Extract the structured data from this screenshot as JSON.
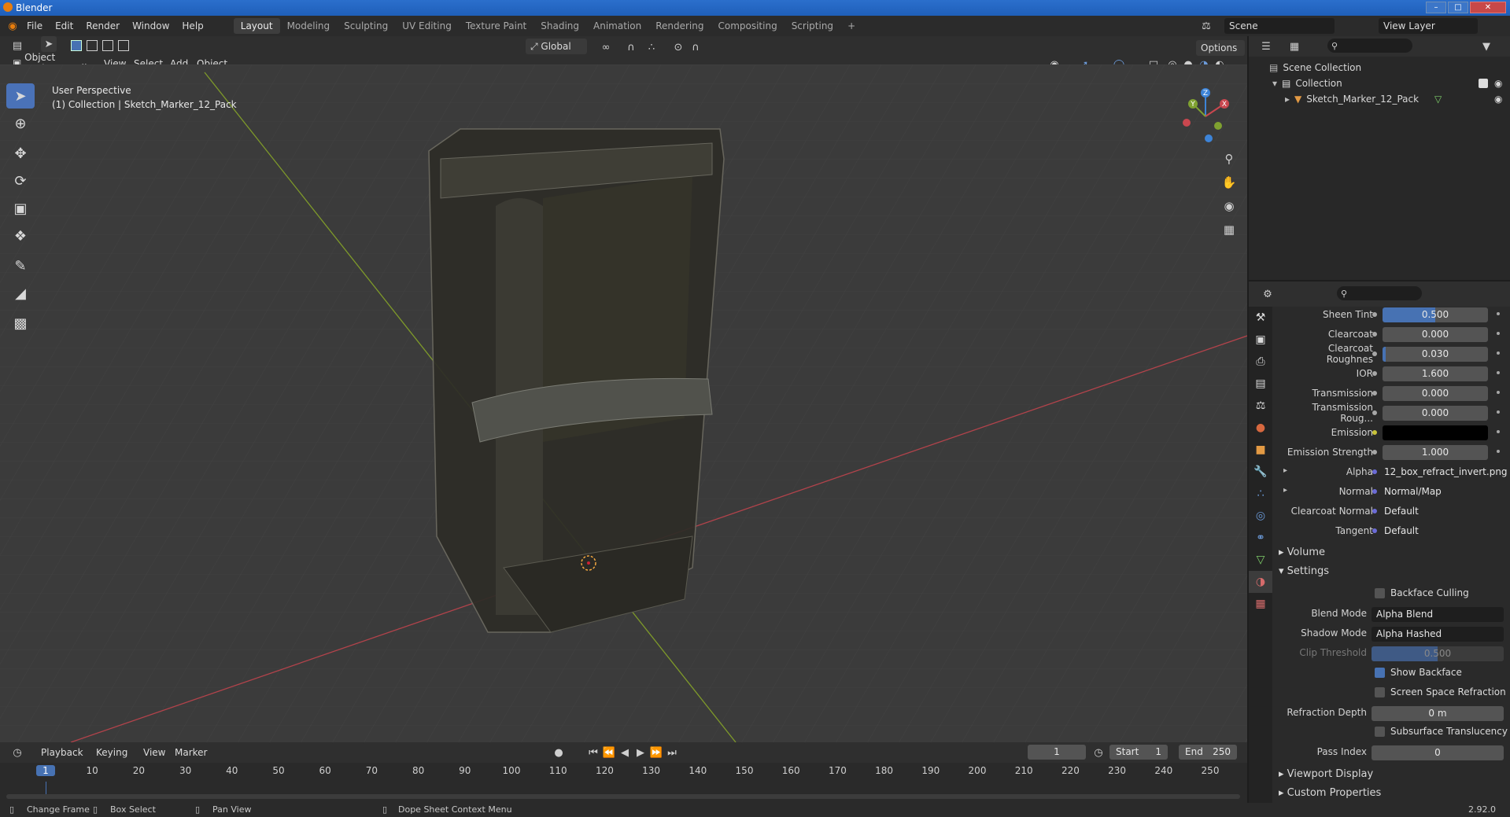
{
  "window": {
    "title": "Blender"
  },
  "menu": [
    "File",
    "Edit",
    "Render",
    "Window",
    "Help"
  ],
  "workspaces": [
    {
      "label": "Layout",
      "active": true
    },
    {
      "label": "Modeling"
    },
    {
      "label": "Sculpting"
    },
    {
      "label": "UV Editing"
    },
    {
      "label": "Texture Paint"
    },
    {
      "label": "Shading"
    },
    {
      "label": "Animation"
    },
    {
      "label": "Rendering"
    },
    {
      "label": "Compositing"
    },
    {
      "label": "Scripting"
    }
  ],
  "scene": {
    "name": "Scene",
    "view_layer": "View Layer"
  },
  "viewport_header": {
    "mode": "Object Mode",
    "menus": [
      "View",
      "Select",
      "Add",
      "Object"
    ],
    "orientation": "Global",
    "options": "Options"
  },
  "viewport": {
    "perspective": "User Perspective",
    "collection_info": "(1) Collection | Sketch_Marker_12_Pack",
    "gizmo_axes": [
      "X",
      "Y",
      "Z"
    ]
  },
  "outliner": {
    "root": "Scene Collection",
    "collection": "Collection",
    "object": "Sketch_Marker_12_Pack"
  },
  "properties": {
    "rows": [
      {
        "label": "Sheen Tint",
        "value": "0.500",
        "fill": 0.5
      },
      {
        "label": "Clearcoat",
        "value": "0.000",
        "fill": 0
      },
      {
        "label": "Clearcoat Roughnes",
        "value": "0.030",
        "fill": 0.03
      },
      {
        "label": "IOR",
        "value": "1.600"
      },
      {
        "label": "Transmission",
        "value": "0.000",
        "fill": 0
      },
      {
        "label": "Transmission Roug...",
        "value": "0.000",
        "fill": 0
      },
      {
        "label": "Emission",
        "value": ""
      },
      {
        "label": "Emission Strength",
        "value": "1.000"
      },
      {
        "label": "Alpha",
        "value": "12_box_refract_invert.png"
      },
      {
        "label": "Normal",
        "value": "Normal/Map"
      },
      {
        "label": "Clearcoat Normal",
        "value": "Default"
      },
      {
        "label": "Tangent",
        "value": "Default"
      }
    ],
    "sections": {
      "volume": "Volume",
      "settings": "Settings",
      "viewport_display": "Viewport Display",
      "custom_properties": "Custom Properties"
    },
    "settings": {
      "backface_culling": "Backface Culling",
      "blend_mode_label": "Blend Mode",
      "blend_mode": "Alpha Blend",
      "shadow_mode_label": "Shadow Mode",
      "shadow_mode": "Alpha Hashed",
      "clip_threshold_label": "Clip Threshold",
      "clip_threshold": "0.500",
      "show_backface": "Show Backface",
      "screen_space_refraction": "Screen Space Refraction",
      "refraction_depth_label": "Refraction Depth",
      "refraction_depth": "0 m",
      "subsurface_translucency": "Subsurface Translucency",
      "pass_index_label": "Pass Index",
      "pass_index": "0"
    }
  },
  "timeline": {
    "menus": [
      "Playback",
      "Keying",
      "View",
      "Marker"
    ],
    "current_frame": "1",
    "start_label": "Start",
    "start": "1",
    "end_label": "End",
    "end": "250",
    "ticks": [
      "1",
      "10",
      "20",
      "30",
      "40",
      "50",
      "60",
      "70",
      "80",
      "90",
      "100",
      "110",
      "120",
      "130",
      "140",
      "150",
      "160",
      "170",
      "180",
      "190",
      "200",
      "210",
      "220",
      "230",
      "240",
      "250"
    ]
  },
  "status": {
    "change_frame": "Change Frame",
    "box_select": "Box Select",
    "pan_view": "Pan View",
    "context_menu": "Dope Sheet Context Menu",
    "version": "2.92.0"
  },
  "colors": {
    "accent": "#4772b3",
    "x_axis": "#c9474f",
    "y_axis": "#7fa130",
    "z_axis": "#3d84d8"
  }
}
